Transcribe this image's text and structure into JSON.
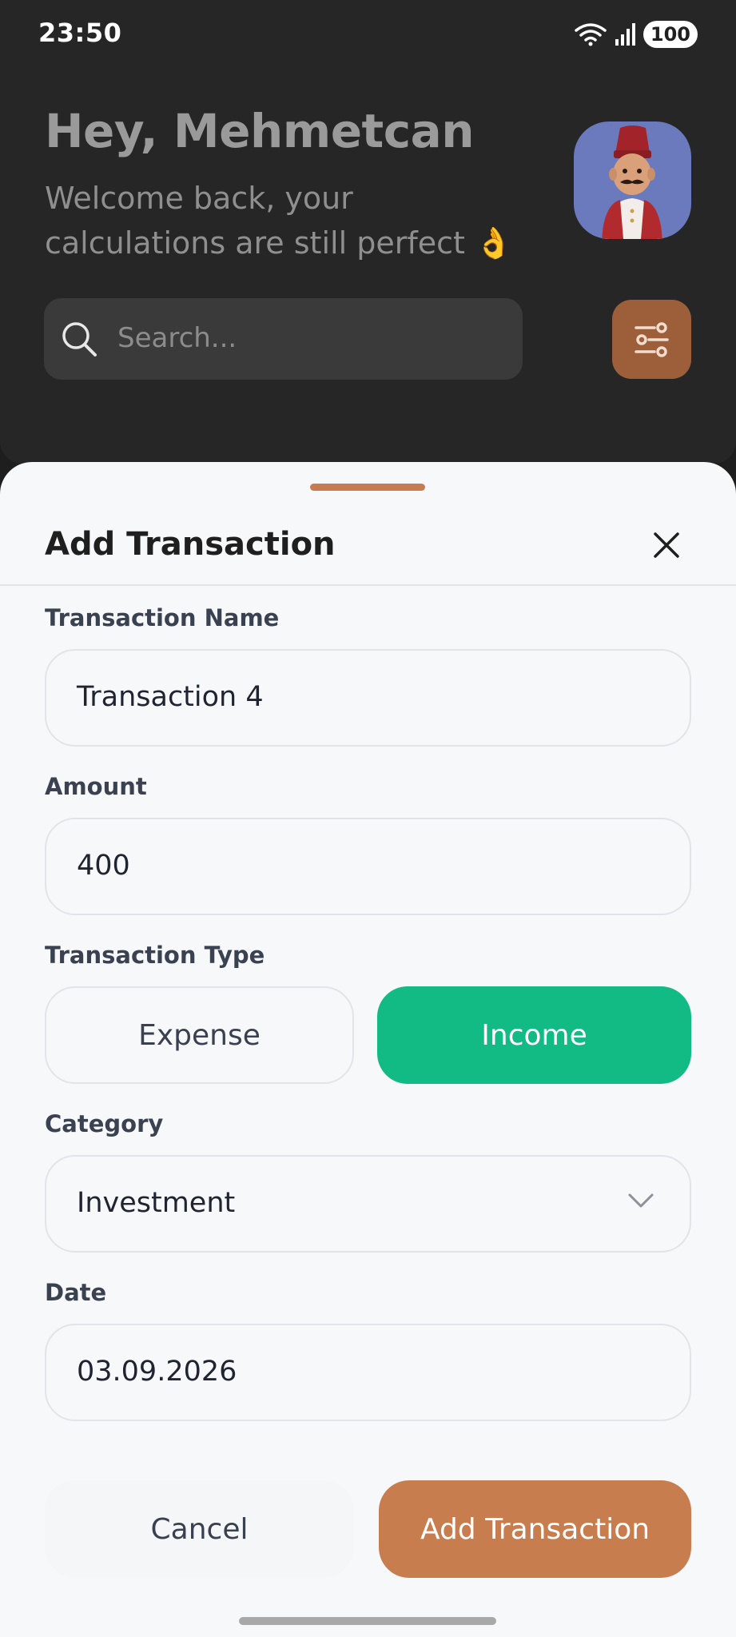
{
  "status_bar": {
    "time": "23:50",
    "battery": "100"
  },
  "header": {
    "greeting": "Hey, Mehmetcan",
    "subtitle": "Welcome back, your calculations are still perfect 👌",
    "avatar_icon": "avatar-fez-man",
    "search_placeholder": "Search...",
    "filter_icon": "sliders-icon"
  },
  "sheet": {
    "title": "Add Transaction",
    "close_icon": "close-icon",
    "fields": {
      "name": {
        "label": "Transaction Name",
        "value": "Transaction 4"
      },
      "amount": {
        "label": "Amount",
        "value": "400"
      },
      "type": {
        "label": "Transaction Type",
        "options": [
          "Expense",
          "Income"
        ],
        "selected": "Income"
      },
      "category": {
        "label": "Category",
        "value": "Investment"
      },
      "date": {
        "label": "Date",
        "value": "03.09.2026"
      }
    },
    "actions": {
      "cancel": "Cancel",
      "submit": "Add Transaction"
    }
  },
  "colors": {
    "accent": "#c87d4f",
    "income_selected": "#13bb84",
    "header_bg": "#262626",
    "sheet_bg": "#f7f8f9"
  }
}
